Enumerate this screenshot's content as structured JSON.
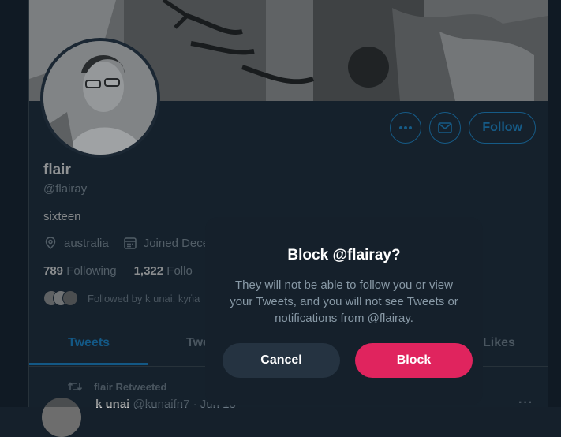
{
  "profile": {
    "display_name": "flair",
    "handle": "@flairay",
    "bio": "sixteen",
    "location": "australia",
    "joined": "Joined Dece",
    "following_count": "789",
    "following_label": "Following",
    "followers_count": "1,322",
    "followers_label": "Follo",
    "followed_by": "Followed by k unai, kyṅa"
  },
  "actions": {
    "more_icon": "more-horizontal-icon",
    "message_icon": "envelope-icon",
    "follow_label": "Follow"
  },
  "tabs": [
    {
      "label": "Tweets"
    },
    {
      "label": "Twe"
    },
    {
      "label": "Likes"
    }
  ],
  "tweet": {
    "retweet_note": "flair Retweeted",
    "author": "k unai",
    "author_handle": "@kunaifn7 · Jun 13"
  },
  "modal": {
    "title": "Block @flairay?",
    "body": "They will not be able to follow you or view your Tweets, and you will not see Tweets or notifications from @flairay.",
    "cancel_label": "Cancel",
    "block_label": "Block"
  },
  "colors": {
    "accent": "#1da1f2",
    "danger": "#e0245e",
    "background": "#15202b"
  }
}
